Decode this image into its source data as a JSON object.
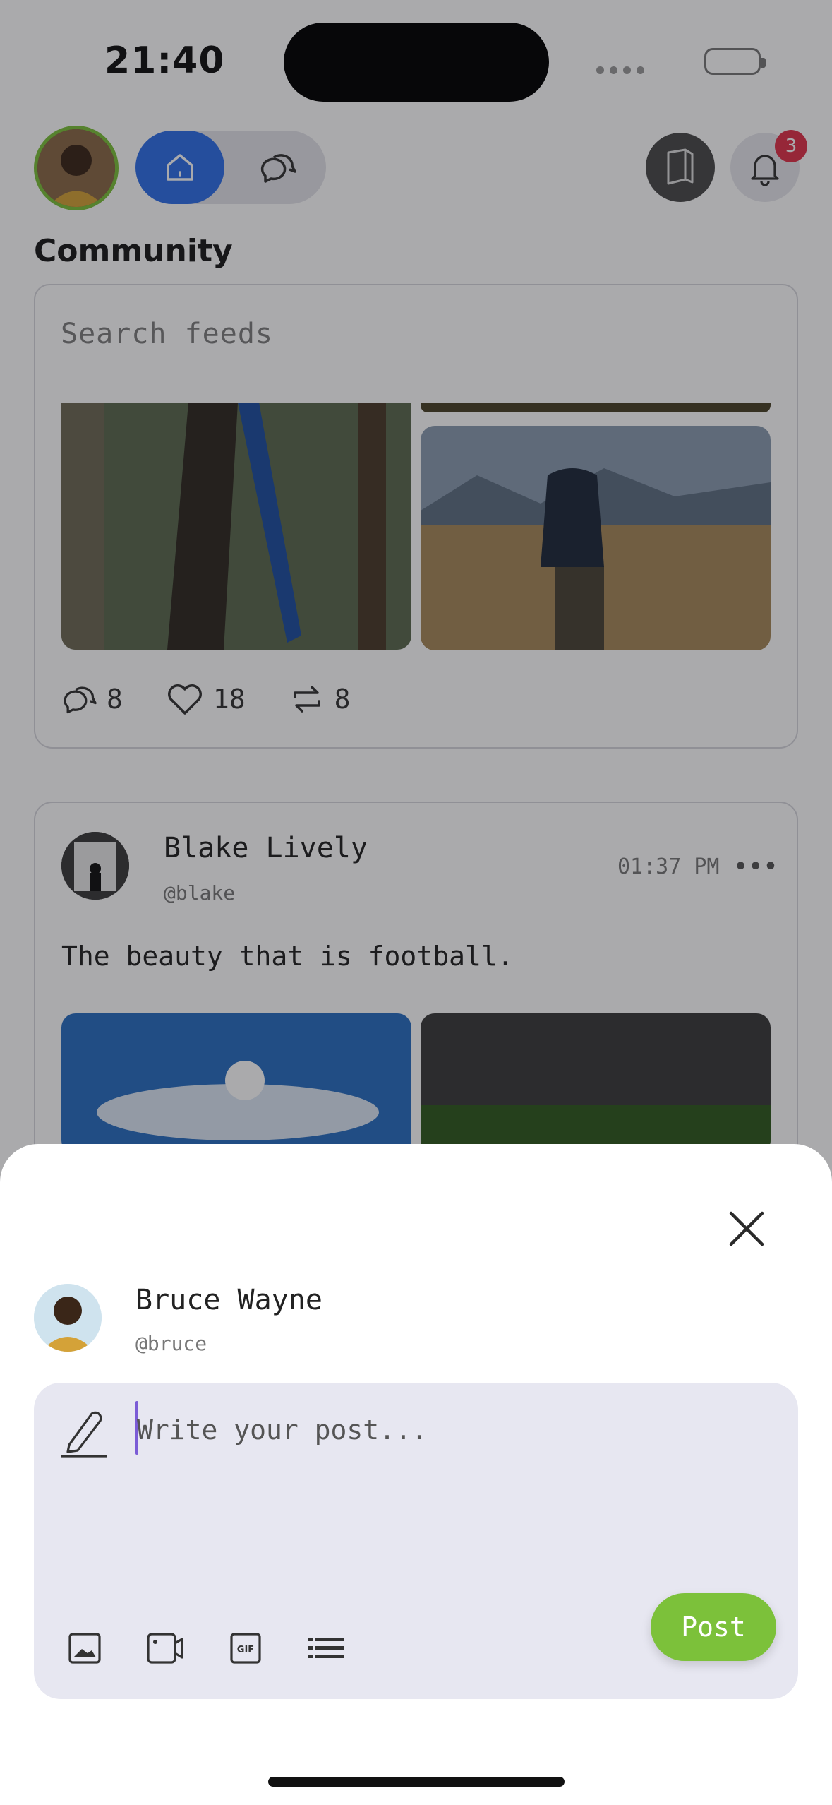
{
  "status": {
    "time": "21:40"
  },
  "header": {
    "notification_count": "3"
  },
  "community": {
    "title": "Community",
    "search_placeholder": "Search feeds"
  },
  "post1": {
    "comments": "8",
    "likes": "18",
    "reposts": "8"
  },
  "post2": {
    "author": "Blake Lively",
    "handle": "@blake",
    "time": "01:37 PM",
    "text": "The beauty that is football."
  },
  "composer": {
    "user_name": "Bruce Wayne",
    "user_handle": "@bruce",
    "placeholder": "Write your post...",
    "post_label": "Post",
    "tools": [
      "image-icon",
      "video-icon",
      "gif-icon",
      "list-icon"
    ]
  },
  "colors": {
    "accent_green": "#7cc13a",
    "home_blue": "#2f6fe8",
    "badge_red": "#e0334a",
    "caret": "#7b5cd6"
  }
}
